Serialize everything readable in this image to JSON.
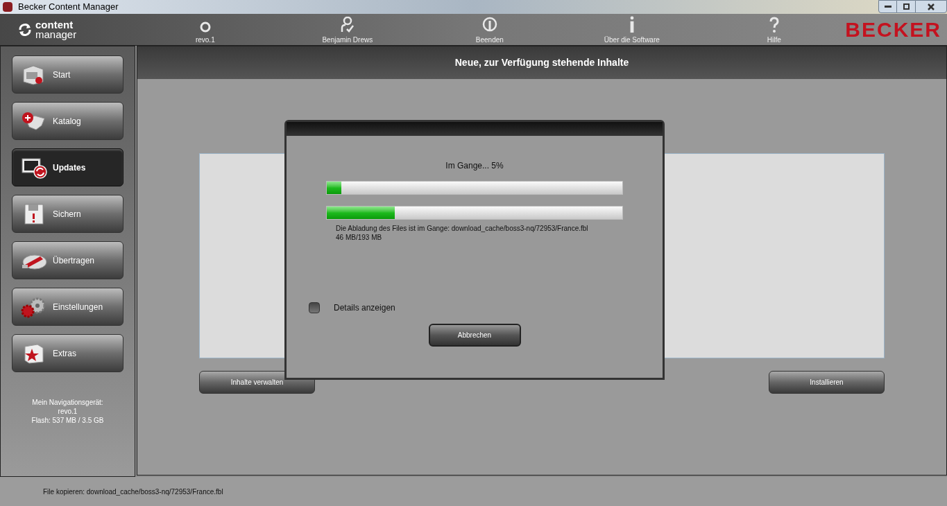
{
  "window": {
    "title": "Becker Content Manager"
  },
  "app_logo": {
    "line_1": "content",
    "line_2": "manager"
  },
  "toolbar": [
    {
      "kind": "device",
      "label": "revo.1"
    },
    {
      "kind": "user",
      "label": "Benjamin Drews"
    },
    {
      "kind": "power",
      "label": "Beenden"
    },
    {
      "kind": "info",
      "label": "Über die Software"
    },
    {
      "kind": "help",
      "label": "Hilfe"
    }
  ],
  "brand": "BECKER",
  "sidebar": {
    "items": [
      {
        "kind": "start",
        "label": "Start",
        "selected": false
      },
      {
        "kind": "catalog",
        "label": "Katalog",
        "selected": false
      },
      {
        "kind": "updates",
        "label": "Updates",
        "selected": true
      },
      {
        "kind": "save",
        "label": "Sichern",
        "selected": false
      },
      {
        "kind": "transfer",
        "label": "Übertragen",
        "selected": false
      },
      {
        "kind": "settings",
        "label": "Einstellungen",
        "selected": false
      },
      {
        "kind": "extras",
        "label": "Extras",
        "selected": false
      }
    ],
    "device_info": [
      "Mein Navigationsgerät:",
      "revo.1",
      "Flash: 537 MB / 3.5 GB"
    ]
  },
  "main": {
    "title": "Neue, zur Verfügung stehende Inhalte",
    "buttons": [
      "Inhalte verwalten",
      "Installieren"
    ]
  },
  "dialog": {
    "status": "Im Gange...  5%",
    "progress": [
      {
        "level": 0.05
      },
      {
        "level": 0.23
      }
    ],
    "message": "Die Abladung des Files ist im Gange:  download_cache/boss3-nq/72953/France.fbl",
    "size": "46 MB/193 MB",
    "details": {
      "label": "Details anzeigen",
      "checked": false
    },
    "cancel": "Abbrechen"
  },
  "status_bar": "File kopieren:  download_cache/boss3-nq/72953/France.fbl"
}
